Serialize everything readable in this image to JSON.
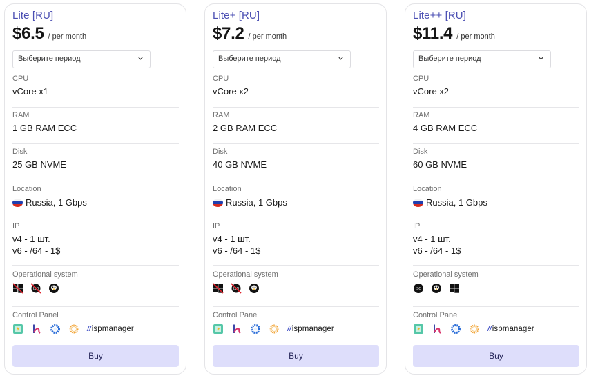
{
  "plans": [
    {
      "title": "Lite [RU]",
      "price": "$6.5",
      "per": "/ per month",
      "period_select": "Выберите период",
      "cpu": {
        "label": "CPU",
        "value": "vCore x1"
      },
      "ram": {
        "label": "RAM",
        "value": "1 GB RAM ECC"
      },
      "disk": {
        "label": "Disk",
        "value": "25 GB NVME"
      },
      "location": {
        "label": "Location",
        "value": "Russia, 1 Gbps",
        "flag": "russia-flag"
      },
      "ip": {
        "label": "IP",
        "v4": "v4 - 1 шт.",
        "v6": "v6 - /64 - 1$"
      },
      "os": {
        "label": "Operational system",
        "icons": [
          "windows-disabled",
          "iso-disabled",
          "linux"
        ]
      },
      "control_panel": {
        "label": "Control Panel",
        "icons": [
          "panel-green",
          "panel-k",
          "panel-blue-ring",
          "panel-orange-ring"
        ],
        "ispmanager": "ispmanager"
      },
      "buy_label": "Buy"
    },
    {
      "title": "Lite+ [RU]",
      "price": "$7.2",
      "per": "/ per month",
      "period_select": "Выберите период",
      "cpu": {
        "label": "CPU",
        "value": "vCore x2"
      },
      "ram": {
        "label": "RAM",
        "value": "2 GB RAM ECC"
      },
      "disk": {
        "label": "Disk",
        "value": "40 GB NVME"
      },
      "location": {
        "label": "Location",
        "value": "Russia, 1 Gbps",
        "flag": "russia-flag"
      },
      "ip": {
        "label": "IP",
        "v4": "v4 - 1 шт.",
        "v6": "v6 - /64 - 1$"
      },
      "os": {
        "label": "Operational system",
        "icons": [
          "windows-disabled",
          "iso-disabled",
          "linux"
        ]
      },
      "control_panel": {
        "label": "Control Panel",
        "icons": [
          "panel-green",
          "panel-k",
          "panel-blue-ring",
          "panel-orange-ring"
        ],
        "ispmanager": "ispmanager"
      },
      "buy_label": "Buy"
    },
    {
      "title": "Lite++ [RU]",
      "price": "$11.4",
      "per": "/ per month",
      "period_select": "Выберите период",
      "cpu": {
        "label": "CPU",
        "value": "vCore x2"
      },
      "ram": {
        "label": "RAM",
        "value": "4 GB RAM ECC"
      },
      "disk": {
        "label": "Disk",
        "value": "60 GB NVME"
      },
      "location": {
        "label": "Location",
        "value": "Russia, 1 Gbps",
        "flag": "russia-flag"
      },
      "ip": {
        "label": "IP",
        "v4": "v4 - 1 шт.",
        "v6": "v6 - /64 - 1$"
      },
      "os": {
        "label": "Operational system",
        "icons": [
          "iso",
          "linux",
          "windows"
        ]
      },
      "control_panel": {
        "label": "Control Panel",
        "icons": [
          "panel-green",
          "panel-k",
          "panel-blue-ring",
          "panel-orange-ring"
        ],
        "ispmanager": "ispmanager"
      },
      "buy_label": "Buy"
    }
  ],
  "colors": {
    "title": "#4b4fb3",
    "buy_bg": "#dedefb",
    "buy_text": "#26265a",
    "divider": "#e6e6e9"
  }
}
